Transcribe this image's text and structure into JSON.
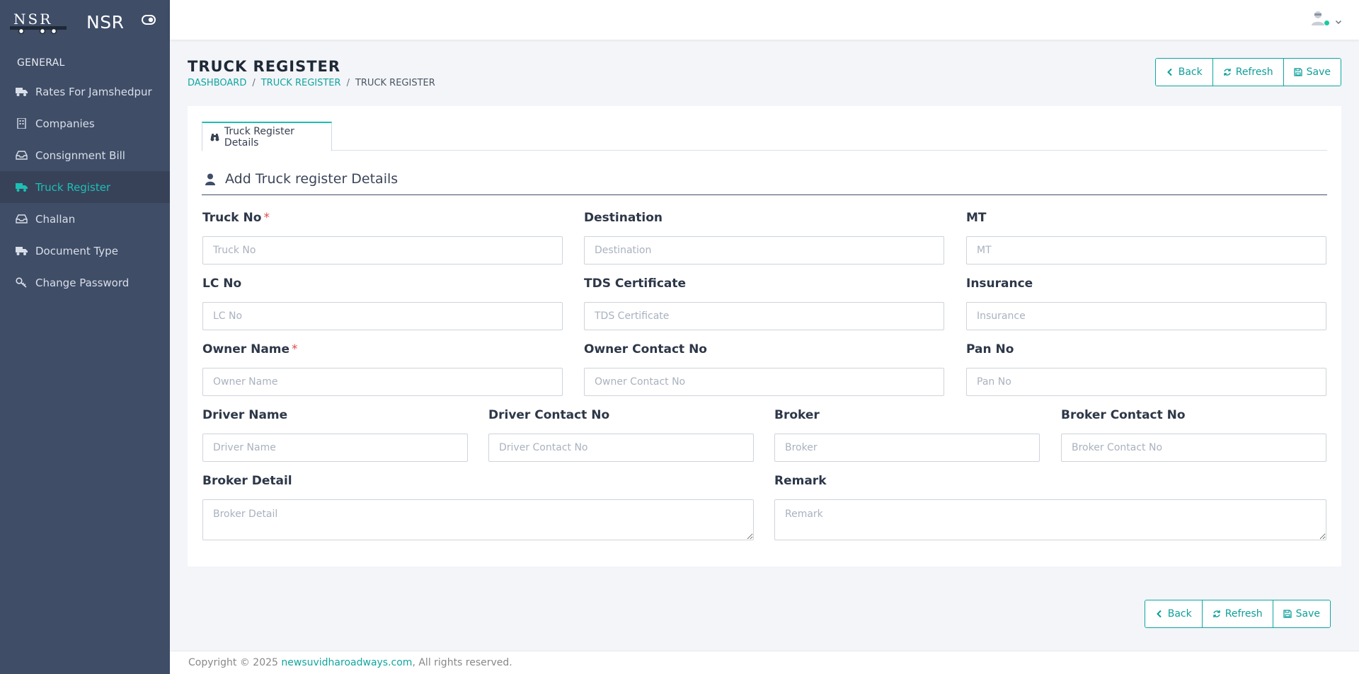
{
  "brand": {
    "logo_text": "NSR",
    "name": "NSR"
  },
  "sidebar": {
    "caption": "GENERAL",
    "items": [
      {
        "label": "Rates For Jamshedpur",
        "icon": "truck-icon",
        "active": false
      },
      {
        "label": "Companies",
        "icon": "building-icon",
        "active": false
      },
      {
        "label": "Consignment Bill",
        "icon": "inbox-icon",
        "active": false
      },
      {
        "label": "Truck Register",
        "icon": "truck-icon",
        "active": true
      },
      {
        "label": "Challan",
        "icon": "inbox-icon",
        "active": false
      },
      {
        "label": "Document Type",
        "icon": "truck-icon",
        "active": false
      },
      {
        "label": "Change Password",
        "icon": "key-icon",
        "active": false
      }
    ]
  },
  "page": {
    "title": "TRUCK REGISTER",
    "breadcrumb": [
      "DASHBOARD",
      "TRUCK REGISTER",
      "TRUCK REGISTER"
    ]
  },
  "actions": {
    "back": "Back",
    "refresh": "Refresh",
    "save": "Save"
  },
  "tab": {
    "label": "Truck Register Details"
  },
  "section": {
    "title": "Add Truck register Details"
  },
  "form": {
    "truck_no": {
      "label": "Truck No",
      "placeholder": "Truck No",
      "required": true
    },
    "destination": {
      "label": "Destination",
      "placeholder": "Destination"
    },
    "mt": {
      "label": "MT",
      "placeholder": "MT"
    },
    "lc_no": {
      "label": "LC No",
      "placeholder": "LC No"
    },
    "tds": {
      "label": "TDS Certificate",
      "placeholder": "TDS Certificate"
    },
    "insurance": {
      "label": "Insurance",
      "placeholder": "Insurance"
    },
    "owner_name": {
      "label": "Owner Name",
      "placeholder": "Owner Name",
      "required": true
    },
    "owner_contact": {
      "label": "Owner Contact No",
      "placeholder": "Owner Contact No"
    },
    "pan_no": {
      "label": "Pan No",
      "placeholder": "Pan No"
    },
    "driver_name": {
      "label": "Driver Name",
      "placeholder": "Driver Name"
    },
    "driver_contact": {
      "label": "Driver Contact No",
      "placeholder": "Driver Contact No"
    },
    "broker": {
      "label": "Broker",
      "placeholder": "Broker"
    },
    "broker_contact": {
      "label": "Broker Contact No",
      "placeholder": "Broker Contact No"
    },
    "broker_detail": {
      "label": "Broker Detail",
      "placeholder": "Broker Detail"
    },
    "remark": {
      "label": "Remark",
      "placeholder": "Remark"
    }
  },
  "footer": {
    "prefix": "Copyright © 2025 ",
    "link": "newsuvidharoadways.com",
    "suffix": ", All rights reserved."
  },
  "colors": {
    "sidebar": "#3f4d67",
    "accent": "#1dbfb3",
    "required": "#e5484d"
  }
}
